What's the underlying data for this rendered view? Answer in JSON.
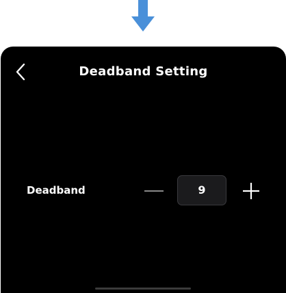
{
  "header": {
    "title": "Deadband Setting",
    "back_icon": "chevron-left-icon"
  },
  "setting": {
    "label": "Deadband",
    "value": "9",
    "decrement_icon": "minus-icon",
    "increment_icon": "plus-icon"
  },
  "indicator": {
    "icon": "arrow-down-icon",
    "color": "#4a90d9"
  },
  "colors": {
    "screen_background": "#000000",
    "text": "#ffffff",
    "value_box_background": "#1b1b1d"
  }
}
